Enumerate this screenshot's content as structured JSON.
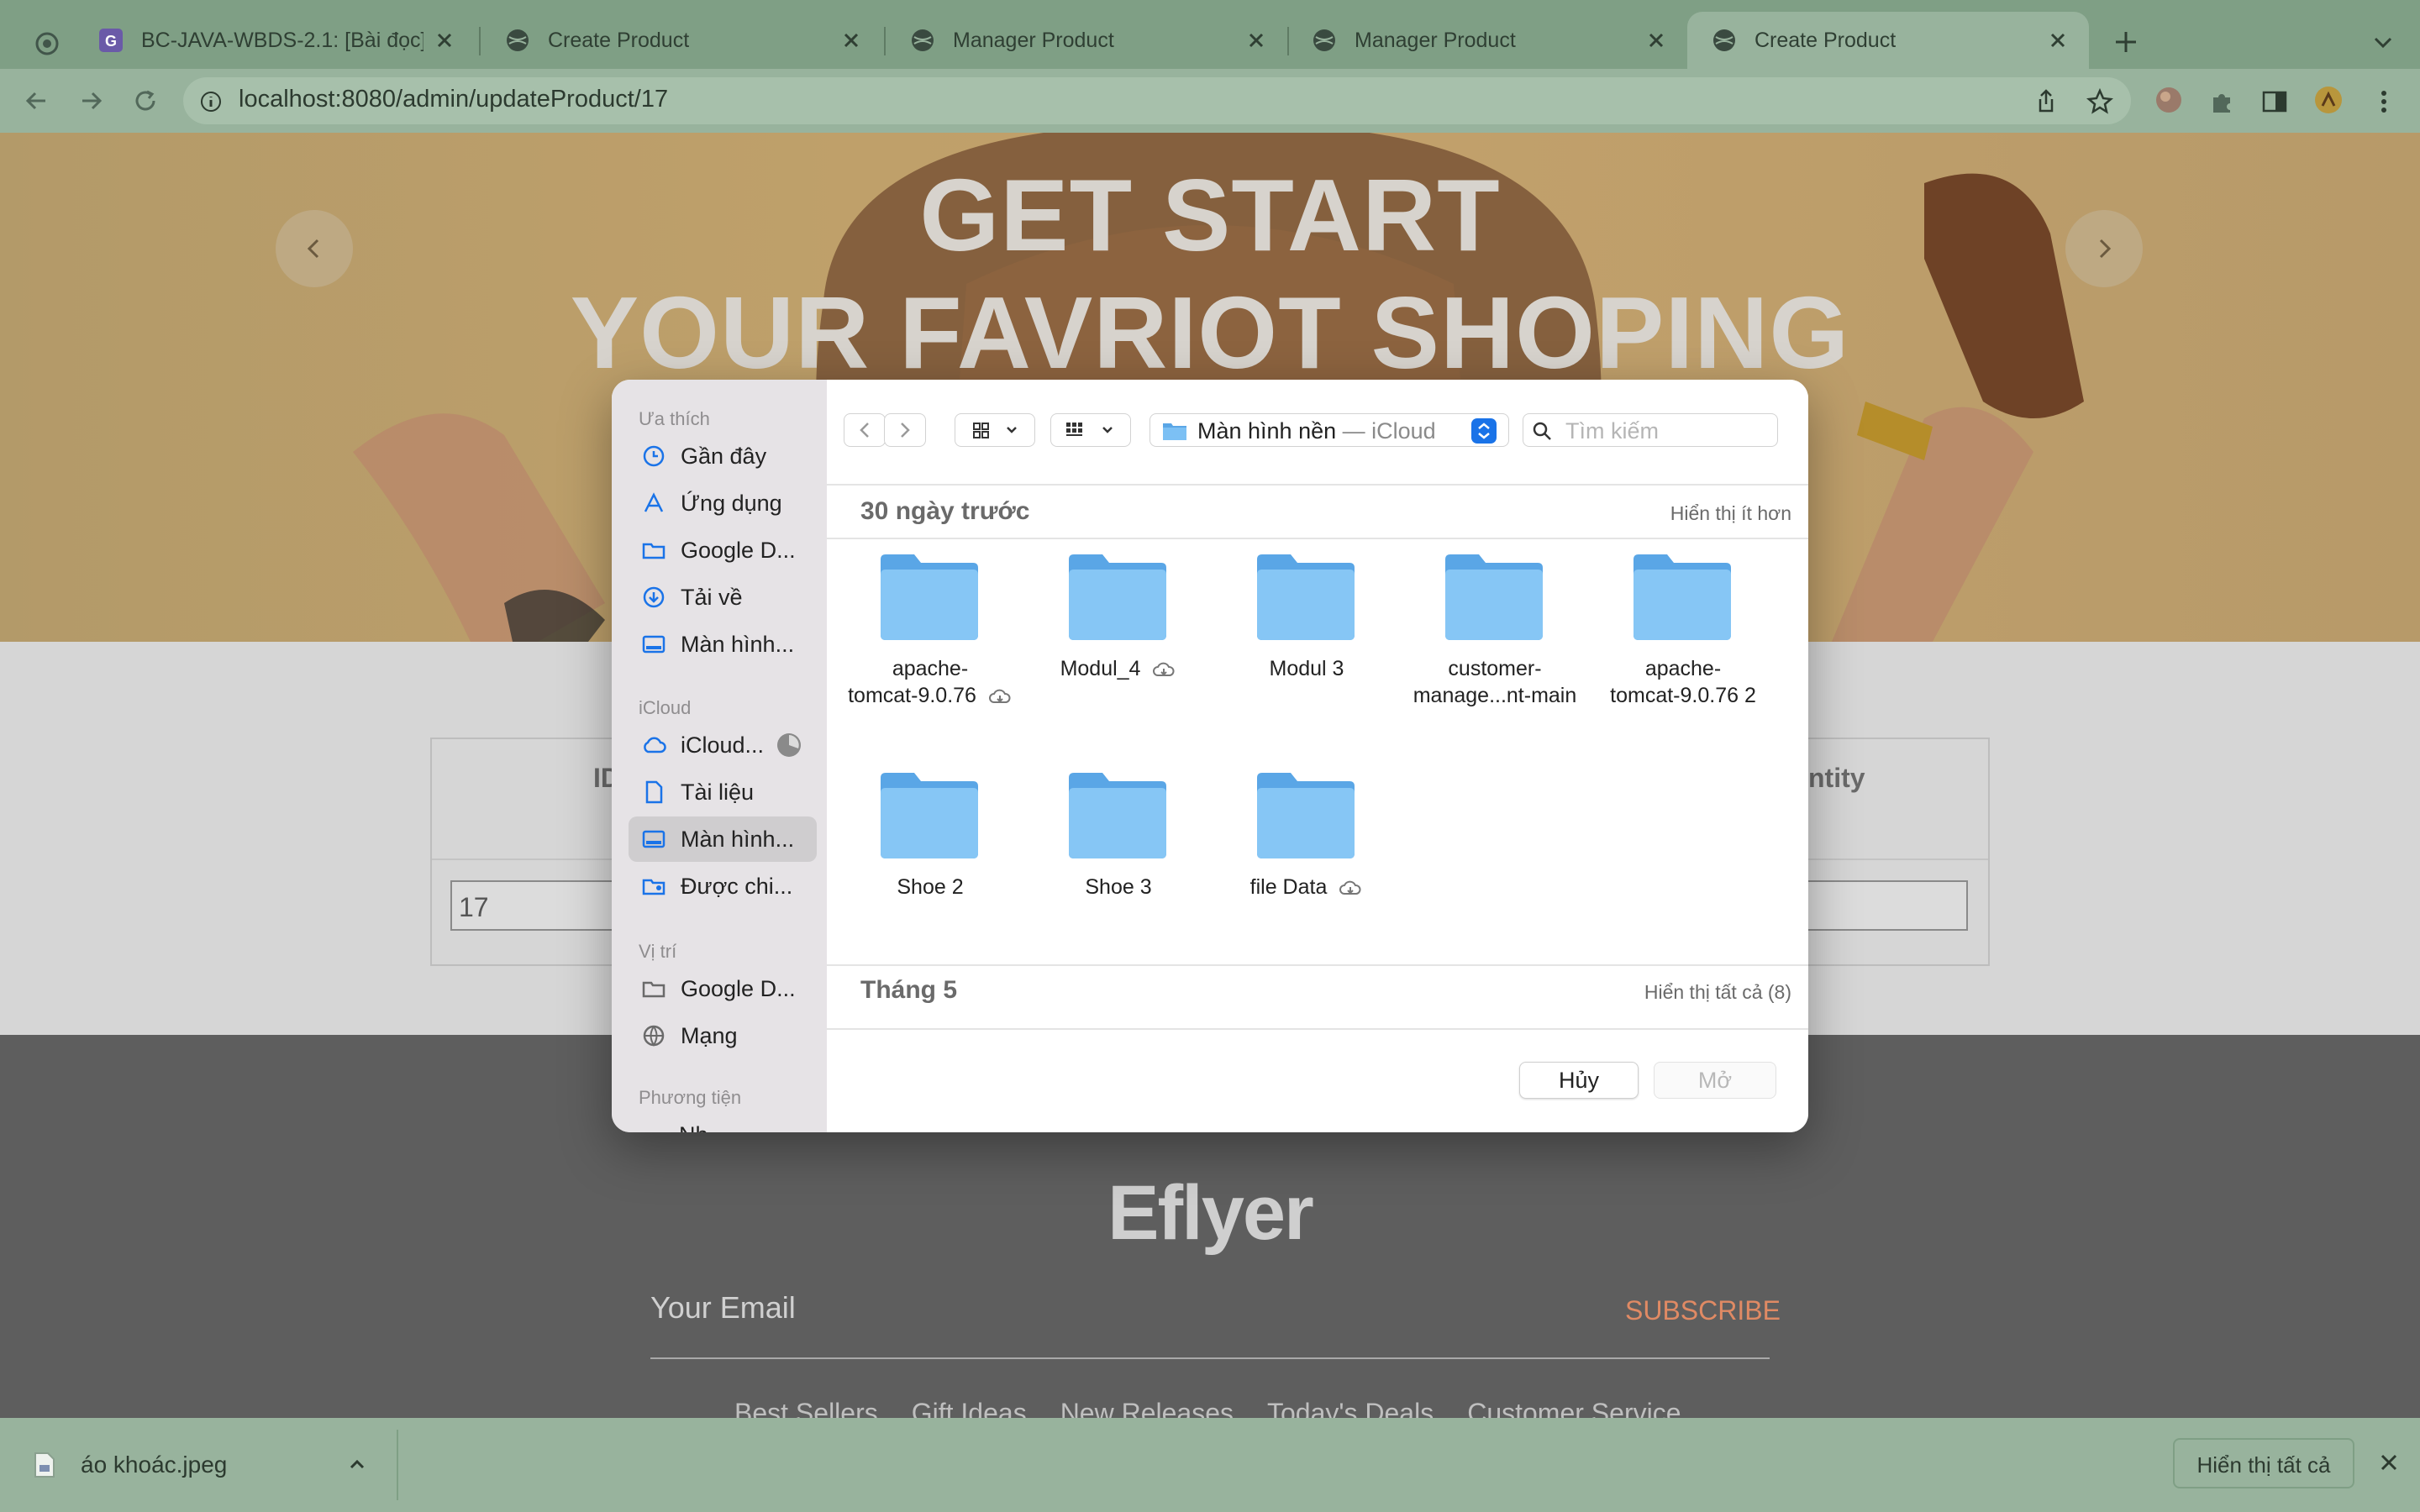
{
  "browser": {
    "tabs": [
      {
        "label": "BC-JAVA-WBDS-2.1: [Bài đọc]"
      },
      {
        "label": "Create Product"
      },
      {
        "label": "Manager Product"
      },
      {
        "label": "Manager Product"
      },
      {
        "label": "Create Product",
        "active": true
      }
    ],
    "url": "localhost:8080/admin/updateProduct/17"
  },
  "page": {
    "hero_line1": "GET START",
    "hero_line2": "YOUR FAVRIOT SHOPING",
    "table": {
      "header_left": "ID",
      "header_right": "ntity",
      "id_value": "17"
    },
    "footer": {
      "logo": "Eflyer",
      "email_placeholder": "Your Email",
      "subscribe": "SUBSCRIBE",
      "links": [
        "Best Sellers",
        "Gift Ideas",
        "New Releases",
        "Today's Deals",
        "Customer Service"
      ]
    }
  },
  "dialog": {
    "sidebar": {
      "favorites_header": "Ưa thích",
      "favorites": [
        "Gần đây",
        "Ứng dụng",
        "Google D...",
        "Tải về",
        "Màn hình..."
      ],
      "icloud_header": "iCloud",
      "icloud": [
        "iCloud...",
        "Tài liệu",
        "Màn hình...",
        "Được chi..."
      ],
      "locations_header": "Vị trí",
      "locations": [
        "Google D...",
        "Mạng"
      ],
      "media_header": "Phương tiện",
      "media_partial": "Nh..."
    },
    "location": "Màn hình nền",
    "location_suffix": " — iCloud",
    "search_placeholder": "Tìm kiếm",
    "section1": {
      "title": "30 ngày trước",
      "action": "Hiển thị ít hơn"
    },
    "section2": {
      "title": "Tháng 5",
      "action": "Hiển thị tất cả (8)"
    },
    "folders": [
      {
        "line1": "apache-",
        "line2": "tomcat-9.0.76",
        "cloud": true
      },
      {
        "line1": "Modul_4",
        "line2": "",
        "cloud": true
      },
      {
        "line1": "Modul 3",
        "line2": "",
        "cloud": false
      },
      {
        "line1": "customer-",
        "line2": "manage...nt-main",
        "cloud": false
      },
      {
        "line1": "apache-",
        "line2": "tomcat-9.0.76 2",
        "cloud": false
      },
      {
        "line1": "Shoe 2",
        "line2": "",
        "cloud": false
      },
      {
        "line1": "Shoe 3",
        "line2": "",
        "cloud": false
      },
      {
        "line1": "file Data",
        "line2": "",
        "cloud": true
      }
    ],
    "cancel_button": "Hủy",
    "open_button": "Mở"
  },
  "downloads": {
    "file": "áo khoác.jpeg",
    "show_all": "Hiển thị tất cả"
  },
  "colors": {
    "accent": "#1a73e8",
    "folder": "#6cb6ee",
    "subscribe": "#e08a64"
  }
}
